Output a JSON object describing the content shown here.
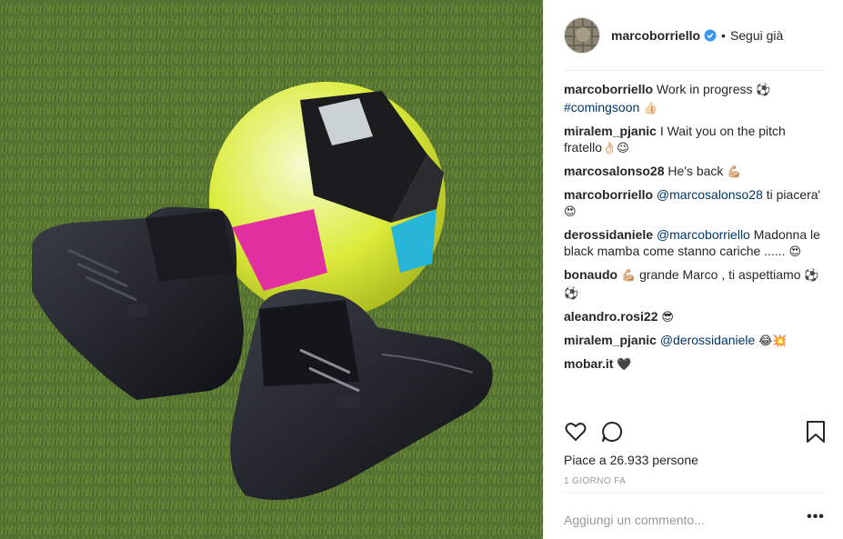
{
  "post": {
    "username": "marcoborriello",
    "follow_separator": "•",
    "follow_label": "Segui già",
    "comments": [
      {
        "user": "marcoborriello",
        "parts": [
          {
            "t": "text",
            "v": "Work in progress "
          },
          {
            "t": "emoji",
            "v": "⚽"
          },
          {
            "t": "br"
          },
          {
            "t": "hashtag",
            "v": "#comingsoon"
          },
          {
            "t": "text",
            "v": " "
          },
          {
            "t": "emoji",
            "v": "👍🏻"
          }
        ]
      },
      {
        "user": "miralem_pjanic",
        "parts": [
          {
            "t": "text",
            "v": "I Wait you on the pitch fratello"
          },
          {
            "t": "emoji",
            "v": "👌🏻😉"
          }
        ]
      },
      {
        "user": "marcosalonso28",
        "parts": [
          {
            "t": "text",
            "v": "He's back "
          },
          {
            "t": "emoji",
            "v": "💪🏼"
          }
        ]
      },
      {
        "user": "marcoborriello",
        "parts": [
          {
            "t": "mention",
            "v": "@marcosalonso28"
          },
          {
            "t": "text",
            "v": " ti piacera' "
          },
          {
            "t": "emoji",
            "v": "😍"
          }
        ]
      },
      {
        "user": "derossidaniele",
        "parts": [
          {
            "t": "mention",
            "v": "@marcoborriello"
          },
          {
            "t": "text",
            "v": " Madonna le black mamba come stanno cariche ...... "
          },
          {
            "t": "emoji",
            "v": "😍"
          }
        ]
      },
      {
        "user": "bonaudo",
        "parts": [
          {
            "t": "emoji",
            "v": "💪🏼"
          },
          {
            "t": "text",
            "v": " grande Marco , ti aspettiamo "
          },
          {
            "t": "emoji",
            "v": "⚽⚽"
          }
        ]
      },
      {
        "user": "aleandro.rosi22",
        "parts": [
          {
            "t": "emoji",
            "v": "😎"
          }
        ]
      },
      {
        "user": "miralem_pjanic",
        "parts": [
          {
            "t": "mention",
            "v": "@derossidaniele"
          },
          {
            "t": "text",
            "v": " "
          },
          {
            "t": "emoji",
            "v": "😂💥"
          }
        ]
      },
      {
        "user": "mobar.it",
        "parts": [
          {
            "t": "emoji",
            "v": "🖤"
          }
        ]
      }
    ],
    "likes_text": "Piace a 26.933 persone",
    "timestamp": "1 GIORNO FA",
    "add_comment_placeholder": "Aggiungi un commento...",
    "more_label": "•••",
    "icons": {
      "like": "heart-icon",
      "comment": "comment-bubble-icon",
      "save": "bookmark-icon",
      "verified": "verified-badge-icon"
    },
    "colors": {
      "link": "#003569",
      "text": "#262626",
      "muted": "#999999",
      "verified": "#3897f0"
    }
  }
}
